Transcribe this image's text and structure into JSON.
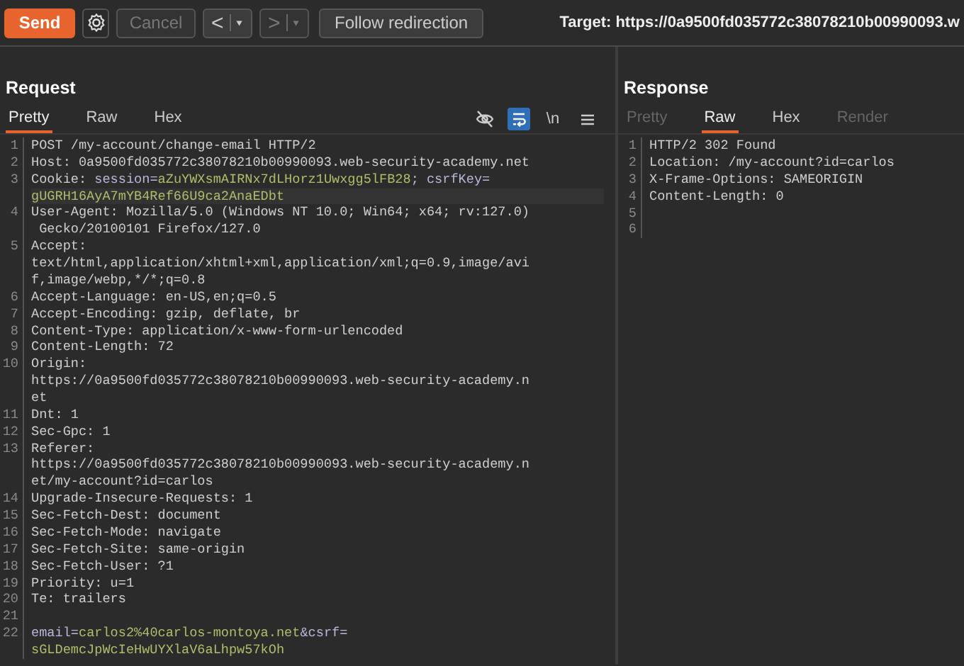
{
  "toolbar": {
    "send": {
      "label": "Send"
    },
    "cancel": {
      "label": "Cancel",
      "disabled": true
    },
    "nav": [
      {
        "label": "<",
        "disabled": false
      },
      {
        "label": ">",
        "disabled": true
      }
    ],
    "follow": {
      "label": "Follow redirection",
      "disabled": false
    },
    "target": "Target: https://0a9500fd035772c38078210b00990093.w"
  },
  "request": {
    "title": "Request",
    "tabs": [
      {
        "label": "Pretty",
        "selected": true,
        "disabled": false
      },
      {
        "label": "Raw",
        "selected": false,
        "disabled": false
      },
      {
        "label": "Hex",
        "selected": false,
        "disabled": false
      }
    ],
    "tools": [
      {
        "kind": "hide",
        "on": false
      },
      {
        "kind": "wrap",
        "on": true
      },
      {
        "kind": "newline",
        "label": "\\n",
        "on": false
      },
      {
        "kind": "menu",
        "on": false
      }
    ],
    "lines": [
      {
        "number": "1",
        "rows": [
          "POST /my-account/change-email HTTP/2"
        ]
      },
      {
        "number": "2",
        "rows": [
          "Host: 0a9500fd035772c38078210b00990093.web-security-academy.net"
        ]
      },
      {
        "number": "3",
        "current": true,
        "rows": [
          [
            {
              "kind": "plain",
              "text": "Cookie: "
            },
            {
              "kind": "name",
              "text": "session="
            },
            {
              "kind": "value",
              "text": "aZuYWXsmAIRNx7dLHorz1Uwxgg5lFB28"
            },
            {
              "kind": "name",
              "text": "; csrfKey="
            }
          ],
          [
            {
              "kind": "value",
              "text": "gUGRH16AyA7mYB4Ref66U9ca2AnaEDbt"
            }
          ]
        ]
      },
      {
        "number": "4",
        "rows": [
          "User-Agent: Mozilla/5.0 (Windows NT 10.0; Win64; x64; rv:127.0)",
          " Gecko/20100101 Firefox/127.0"
        ]
      },
      {
        "number": "5",
        "rows": [
          "Accept:",
          "text/html,application/xhtml+xml,application/xml;q=0.9,image/avi",
          "f,image/webp,*/*;q=0.8"
        ]
      },
      {
        "number": "6",
        "rows": [
          "Accept-Language: en-US,en;q=0.5"
        ]
      },
      {
        "number": "7",
        "rows": [
          "Accept-Encoding: gzip, deflate, br"
        ]
      },
      {
        "number": "8",
        "rows": [
          "Content-Type: application/x-www-form-urlencoded"
        ]
      },
      {
        "number": "9",
        "rows": [
          "Content-Length: 72"
        ]
      },
      {
        "number": "10",
        "rows": [
          "Origin:",
          "https://0a9500fd035772c38078210b00990093.web-security-academy.n",
          "et"
        ]
      },
      {
        "number": "11",
        "rows": [
          "Dnt: 1"
        ]
      },
      {
        "number": "12",
        "rows": [
          "Sec-Gpc: 1"
        ]
      },
      {
        "number": "13",
        "rows": [
          "Referer:",
          "https://0a9500fd035772c38078210b00990093.web-security-academy.n",
          "et/my-account?id=carlos"
        ]
      },
      {
        "number": "14",
        "rows": [
          "Upgrade-Insecure-Requests: 1"
        ]
      },
      {
        "number": "15",
        "rows": [
          "Sec-Fetch-Dest: document"
        ]
      },
      {
        "number": "16",
        "rows": [
          "Sec-Fetch-Mode: navigate"
        ]
      },
      {
        "number": "17",
        "rows": [
          "Sec-Fetch-Site: same-origin"
        ]
      },
      {
        "number": "18",
        "rows": [
          "Sec-Fetch-User: ?1"
        ]
      },
      {
        "number": "19",
        "rows": [
          "Priority: u=1"
        ]
      },
      {
        "number": "20",
        "rows": [
          "Te: trailers"
        ]
      },
      {
        "number": "21"
      },
      {
        "number": "22",
        "rows": [
          [
            {
              "kind": "name",
              "text": "email="
            },
            {
              "kind": "value",
              "text": "carlos2%40carlos-montoya.net"
            },
            {
              "kind": "name",
              "text": "&csrf="
            }
          ],
          [
            {
              "kind": "value",
              "text": "sGLDemcJpWcIeHwUYXlaV6aLhpw57kOh"
            }
          ]
        ]
      }
    ]
  },
  "response": {
    "title": "Response",
    "tabs": [
      {
        "label": "Pretty",
        "selected": false,
        "disabled": true
      },
      {
        "label": "Raw",
        "selected": true,
        "disabled": false
      },
      {
        "label": "Hex",
        "selected": false,
        "disabled": false
      },
      {
        "label": "Render",
        "selected": false,
        "disabled": true
      }
    ],
    "lines": [
      {
        "number": "1",
        "rows": [
          "HTTP/2 302 Found"
        ]
      },
      {
        "number": "2",
        "rows": [
          "Location: /my-account?id=carlos"
        ]
      },
      {
        "number": "3",
        "rows": [
          "X-Frame-Options: SAMEORIGIN"
        ]
      },
      {
        "number": "4",
        "rows": [
          "Content-Length: 0"
        ]
      },
      {
        "number": "5"
      },
      {
        "number": "6"
      }
    ]
  }
}
